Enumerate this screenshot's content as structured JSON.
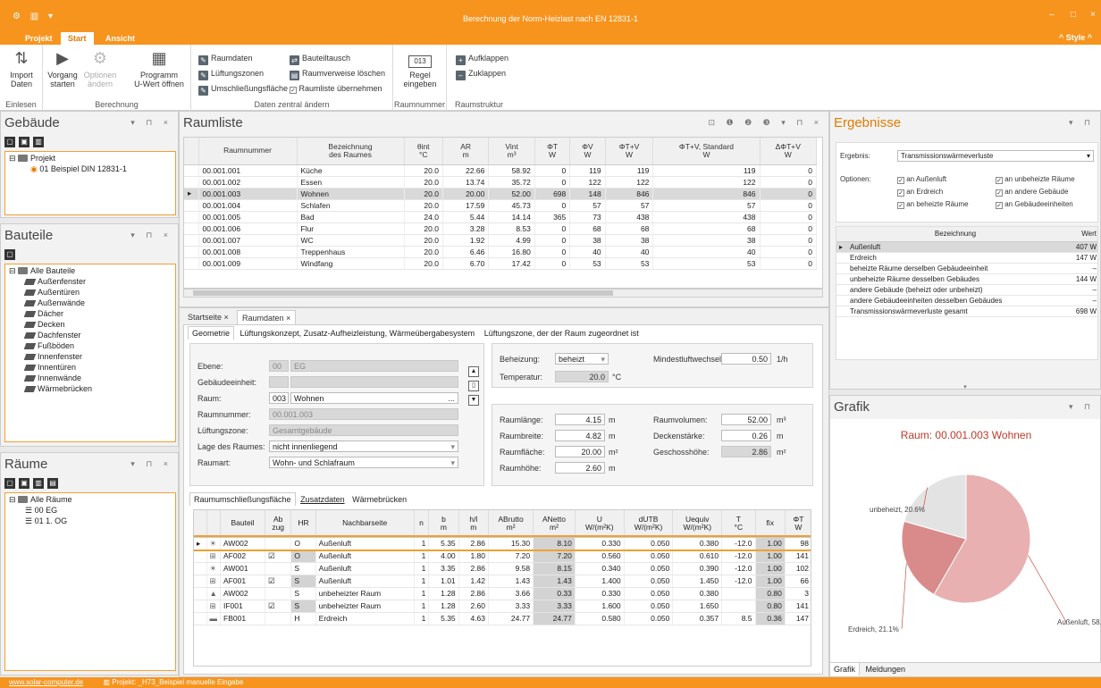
{
  "window": {
    "title": "Berechnung der Norm-Heizlast nach EN 12831-1",
    "style_label": "^ Style ^"
  },
  "menu": {
    "tabs": [
      "Projekt",
      "Start",
      "Ansicht"
    ]
  },
  "ribbon": {
    "einlesen": {
      "label": "Einlesen",
      "import": "Import\nDaten"
    },
    "berechnung": {
      "label": "Berechnung",
      "vorgang": "Vorgang\nstarten",
      "optionen": "Optionen\nändern",
      "programm": "Programm\nU-Wert öffnen"
    },
    "daten": {
      "label": "Daten zentral ändern",
      "raumdaten": "Raumdaten",
      "lueftungszonen": "Lüftungszonen",
      "umschliessung": "Umschließungsfläche",
      "bauteiltausch": "Bauteiltausch",
      "raumverweise": "Raumverweise löschen",
      "raumliste": "Raumliste übernehmen"
    },
    "raumnummer": {
      "label": "Raumnummer",
      "badge": "013",
      "regel": "Regel\neingeben"
    },
    "raumstruktur": {
      "label": "Raumstruktur",
      "aufklappen": "Aufklappen",
      "zuklappen": "Zuklappen"
    }
  },
  "gebaeude": {
    "title": "Gebäude",
    "root": "Projekt",
    "item": "01 Beispiel DIN 12831-1"
  },
  "bauteile": {
    "title": "Bauteile",
    "root": "Alle Bauteile",
    "items": [
      "Außenfenster",
      "Außentüren",
      "Außenwände",
      "Dächer",
      "Decken",
      "Dachfenster",
      "Fußböden",
      "Innenfenster",
      "Innentüren",
      "Innenwände",
      "Wärmebrücken"
    ]
  },
  "raeume": {
    "title": "Räume",
    "root": "Alle Räume",
    "items": [
      "00 EG",
      "01 1. OG"
    ]
  },
  "raumliste": {
    "title": "Raumliste",
    "headers": [
      "Raumnummer",
      "Bezeichnung\ndes Raumes",
      "θint\n°C",
      "AR\nm",
      "Vint\nm³",
      "ΦT\nW",
      "ΦV\nW",
      "ΦT+V\nW",
      "ΦT+V, Standard\nW",
      "ΔΦT+V\nW"
    ],
    "rows": [
      [
        "00.001.001",
        "Küche",
        "20.0",
        "22.66",
        "58.92",
        "0",
        "119",
        "119",
        "119",
        "0"
      ],
      [
        "00.001.002",
        "Essen",
        "20.0",
        "13.74",
        "35.72",
        "0",
        "122",
        "122",
        "122",
        "0"
      ],
      [
        "00.001.003",
        "Wohnen",
        "20.0",
        "20.00",
        "52.00",
        "698",
        "148",
        "846",
        "846",
        "0"
      ],
      [
        "00.001.004",
        "Schlafen",
        "20.0",
        "17.59",
        "45.73",
        "0",
        "57",
        "57",
        "57",
        "0"
      ],
      [
        "00.001.005",
        "Bad",
        "24.0",
        "5.44",
        "14.14",
        "365",
        "73",
        "438",
        "438",
        "0"
      ],
      [
        "00.001.006",
        "Flur",
        "20.0",
        "3.28",
        "8.53",
        "0",
        "68",
        "68",
        "68",
        "0"
      ],
      [
        "00.001.007",
        "WC",
        "20.0",
        "1.92",
        "4.99",
        "0",
        "38",
        "38",
        "38",
        "0"
      ],
      [
        "00.001.008",
        "Treppenhaus",
        "20.0",
        "6.46",
        "16.80",
        "0",
        "40",
        "40",
        "40",
        "0"
      ],
      [
        "00.001.009",
        "Windfang",
        "20.0",
        "6.70",
        "17.42",
        "0",
        "53",
        "53",
        "53",
        "0"
      ]
    ]
  },
  "doctabs": [
    "Startseite",
    "Raumdaten"
  ],
  "subtabs": [
    "Geometrie",
    "Lüftungskonzept, Zusatz-Aufheizleistung, Wärmeübergabesystem",
    "Lüftungszone, der der Raum zugeordnet ist"
  ],
  "form": {
    "ebene_l": "Ebene:",
    "ebene_n": "00",
    "ebene_v": "EG",
    "gebeinheit_l": "Gebäudeeinheit:",
    "raum_l": "Raum:",
    "raum_n": "003",
    "raum_v": "Wohnen",
    "raumnummer_l": "Raumnummer:",
    "raumnummer_v": "00.001.003",
    "lueftung_l": "Lüftungszone:",
    "lueftung_v": "Gesamtgebäude",
    "lage_l": "Lage des Raumes:",
    "lage_v": "nicht innenliegend",
    "raumart_l": "Raumart:",
    "raumart_v": "Wohn- und Schlafraum",
    "beheizung_l": "Beheizung:",
    "beheizung_v": "beheizt",
    "temp_l": "Temperatur:",
    "temp_v": "20.0",
    "temp_u": "°C",
    "mindest_l": "Mindestluftwechsel:",
    "mindest_v": "0.50",
    "mindest_u": "1/h",
    "laenge_l": "Raumlänge:",
    "laenge_v": "4.15",
    "laenge_u": "m",
    "breite_l": "Raumbreite:",
    "breite_v": "4.82",
    "breite_u": "m",
    "flaeche_l": "Raumfläche:",
    "flaeche_v": "20.00",
    "flaeche_u": "m²",
    "hoehe_l": "Raumhöhe:",
    "hoehe_v": "2.60",
    "hoehe_u": "m",
    "volumen_l": "Raumvolumen:",
    "volumen_v": "52.00",
    "volumen_u": "m³",
    "decke_l": "Deckenstärke:",
    "decke_v": "0.26",
    "decke_u": "m",
    "geschoss_l": "Geschosshöhe:",
    "geschoss_v": "2.86",
    "geschoss_u": "m²"
  },
  "utabs": [
    "Raumumschließungsfläche",
    "Zusatzdaten",
    "Wärmebrücken"
  ],
  "ut": {
    "headers": [
      "Bauteil",
      "Ab\nzug",
      "HR",
      "Nachbarseite",
      "n",
      "b\nm",
      "h/l\nm",
      "ABrutto\nm²",
      "ANetto\nm²",
      "U\nW/(m²K)",
      "dUTB\nW/(m²K)",
      "Uequiv\nW/(m²K)",
      "T\n°C",
      "fix",
      "ΦT\nW"
    ],
    "rows": [
      [
        "AW002",
        "",
        "O",
        "Außenluft",
        "1",
        "5.35",
        "2.86",
        "15.30",
        "8.10",
        "0.330",
        "0.050",
        "0.380",
        "-12.0",
        "1.00",
        "98"
      ],
      [
        "AF002",
        "☑",
        "O",
        "Außenluft",
        "1",
        "4.00",
        "1.80",
        "7.20",
        "7.20",
        "0.560",
        "0.050",
        "0.610",
        "-12.0",
        "1.00",
        "141"
      ],
      [
        "AW001",
        "",
        "S",
        "Außenluft",
        "1",
        "3.35",
        "2.86",
        "9.58",
        "8.15",
        "0.340",
        "0.050",
        "0.390",
        "-12.0",
        "1.00",
        "102"
      ],
      [
        "AF001",
        "☑",
        "S",
        "Außenluft",
        "1",
        "1.01",
        "1.42",
        "1.43",
        "1.43",
        "1.400",
        "0.050",
        "1.450",
        "-12.0",
        "1.00",
        "66"
      ],
      [
        "AW002",
        "",
        "S",
        "unbeheizter Raum",
        "1",
        "1.28",
        "2.86",
        "3.66",
        "0.33",
        "0.330",
        "0.050",
        "0.380",
        "",
        "0.80",
        "3"
      ],
      [
        "IF001",
        "☑",
        "S",
        "unbeheizter Raum",
        "1",
        "1.28",
        "2.60",
        "3.33",
        "3.33",
        "1.600",
        "0.050",
        "1.650",
        "",
        "0.80",
        "141"
      ],
      [
        "FB001",
        "",
        "H",
        "Erdreich",
        "1",
        "5.35",
        "4.63",
        "24.77",
        "24.77",
        "0.580",
        "0.050",
        "0.357",
        "8.5",
        "0.36",
        "147"
      ]
    ]
  },
  "ergebnisse": {
    "title": "Ergebnisse",
    "ergebnis_l": "Ergebnis:",
    "ergebnis_v": "Transmissionswärmeverluste",
    "optionen_l": "Optionen:",
    "opts": [
      "an Außenluft",
      "an unbeheizte Räume",
      "an Erdreich",
      "an andere Gebäude",
      "an beheizte Räume",
      "an Gebäudeeinheiten"
    ],
    "headers": [
      "Bezeichnung",
      "Wert"
    ],
    "rows": [
      [
        "Außenluft",
        "407 W"
      ],
      [
        "Erdreich",
        "147 W"
      ],
      [
        "beheizte Räume derselben Gebäudeeinheit",
        "–"
      ],
      [
        "unbeheizte Räume desselben Gebäudes",
        "144 W"
      ],
      [
        "andere Gebäude (beheizt oder unbeheizt)",
        "–"
      ],
      [
        "andere Gebäudeeinheiten desselben Gebäudes",
        "–"
      ],
      [
        "Transmissionswärmeverluste gesamt",
        "698 W"
      ]
    ]
  },
  "grafik": {
    "title": "Grafik",
    "tabs": [
      "Grafik",
      "Meldungen"
    ]
  },
  "chart_data": {
    "type": "pie",
    "title": "Raum: 00.001.003 Wohnen",
    "slices": [
      {
        "label": "Außenluft, 58.3%",
        "value": 58.3,
        "color": "#e8b0b0"
      },
      {
        "label": "Erdreich, 21.1%",
        "value": 21.1,
        "color": "#d98a8a"
      },
      {
        "label": "unbeheizt, 20.6%",
        "value": 20.6,
        "color": "#e3e3e3"
      }
    ]
  },
  "status": {
    "website": "www.solar-computer.de",
    "project": "Projekt: _H73_Beispiel manuelle Eingabe"
  }
}
